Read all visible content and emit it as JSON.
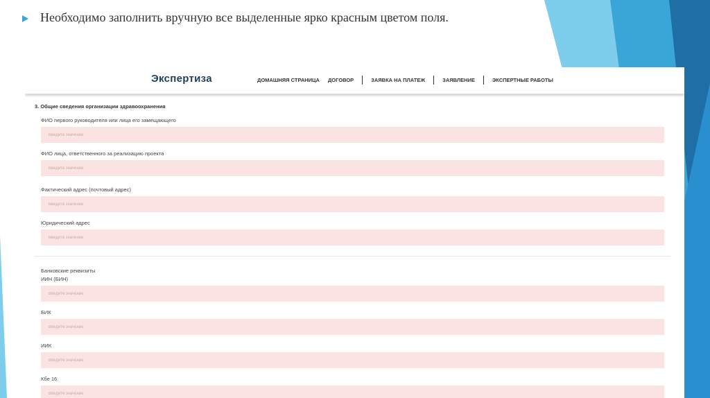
{
  "slide": {
    "heading": "Необходимо заполнить вручную все выделенные ярко красным цветом поля.",
    "bullet_icon": "triangle-bullet-icon",
    "accent_colors": [
      "#3aa6d8",
      "#1f6fa6",
      "#7fcdec"
    ]
  },
  "app": {
    "logo": "Экспертиза",
    "nav": [
      "ДОМАШНЯЯ СТРАНИЦА",
      "ДОГОВОР",
      "ЗАЯВКА НА ПЛАТЕЖ",
      "ЗАЯВЛЕНИЕ",
      "ЭКСПЕРТНЫЕ РАБОТЫ"
    ]
  },
  "form": {
    "section_title": "3. Общие сведения организации здравоохранения",
    "placeholder": "Введите значение",
    "required_field_color": "#fce3e3",
    "fields": [
      "ФИО первого руководителя или лица его замещающего",
      "ФИО лица, ответственного за реализацию проекта",
      "Фактический адрес (почтовый адрес)",
      "Юридический адрес"
    ],
    "bank_section_title": "Банковские реквизиты",
    "bank_fields": [
      "ИИН (БИН)",
      "БИК",
      "ИИК",
      "Кбе 16"
    ]
  }
}
